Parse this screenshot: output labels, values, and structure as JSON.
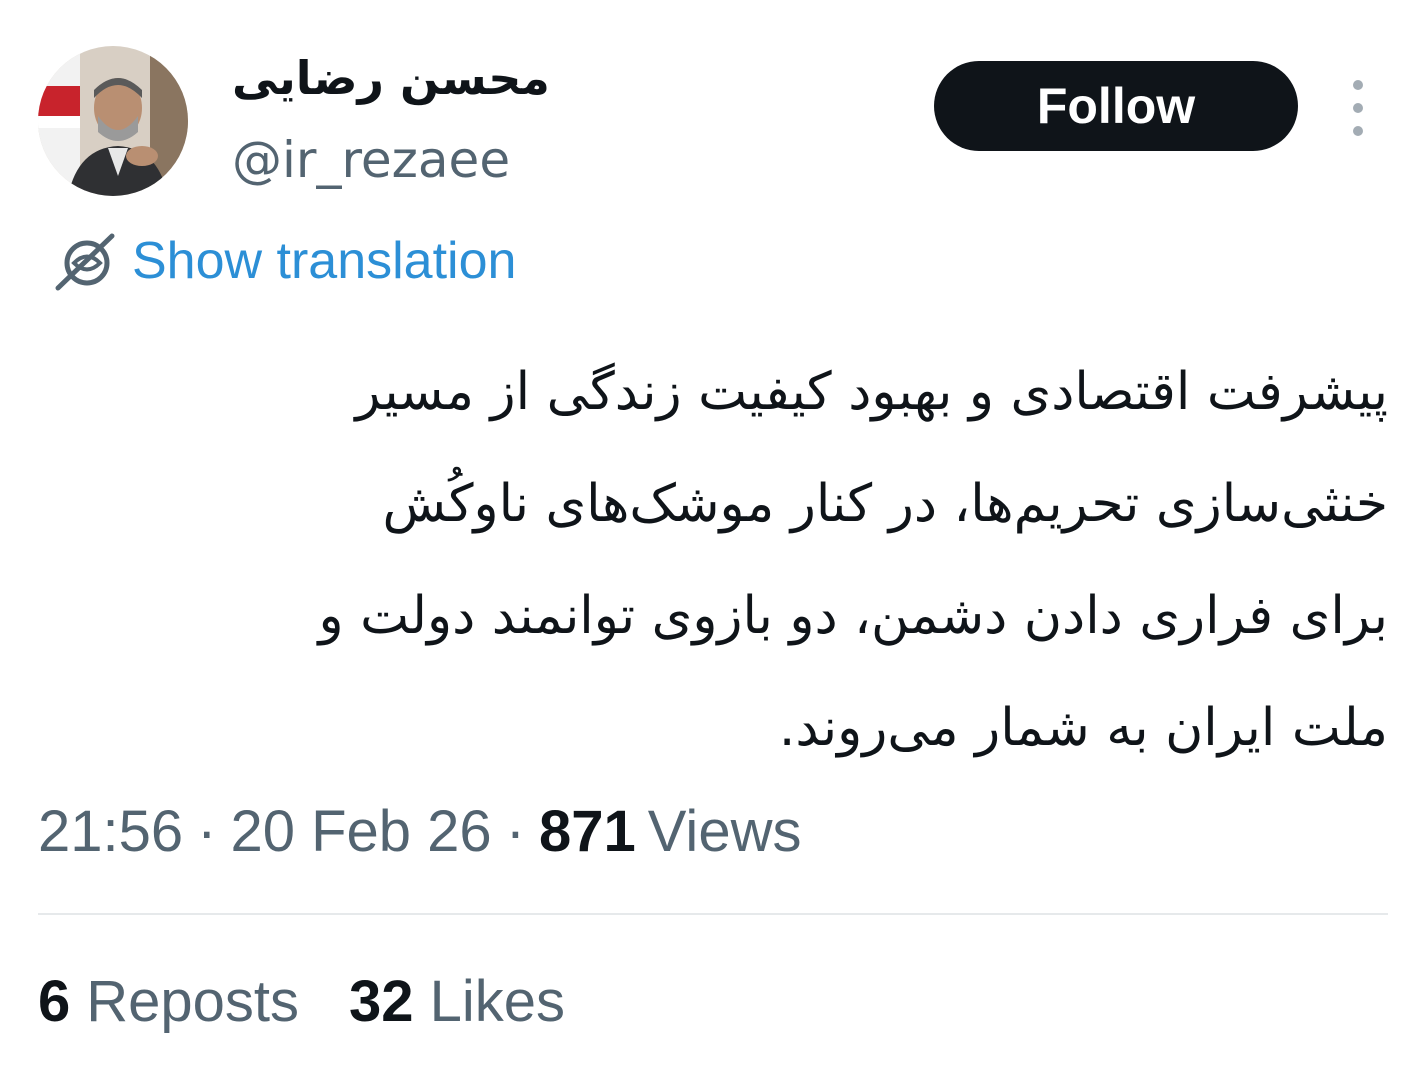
{
  "author": {
    "display_name": "محسن رضایی",
    "handle": "@ir_rezaee"
  },
  "header": {
    "follow_label": "Follow",
    "more_icon": "more-vertical-icon"
  },
  "translation": {
    "icon": "globe-icon",
    "label": "Show translation"
  },
  "tweet": {
    "lines": [
      "پیشرفت اقتصادی و بهبود کیفیت زندگی از مسیر",
      "خنثی‌سازی تحریم‌ها، در کنار موشک‌های ناوکُش",
      "برای فراری دادن دشمن، دو بازوی توانمند دولت و",
      "ملت ایران به شمار می‌روند."
    ]
  },
  "meta": {
    "time": "21:56",
    "separator": "·",
    "date": "20 Feb 26",
    "views_count": "871",
    "views_label": "Views"
  },
  "stats": {
    "reposts_count": "6",
    "reposts_label": "Reposts",
    "likes_count": "32",
    "likes_label": "Likes"
  },
  "colors": {
    "text": "#0f1419",
    "secondary": "#536471",
    "link": "#2c8fd6",
    "button_bg": "#0f1419"
  }
}
